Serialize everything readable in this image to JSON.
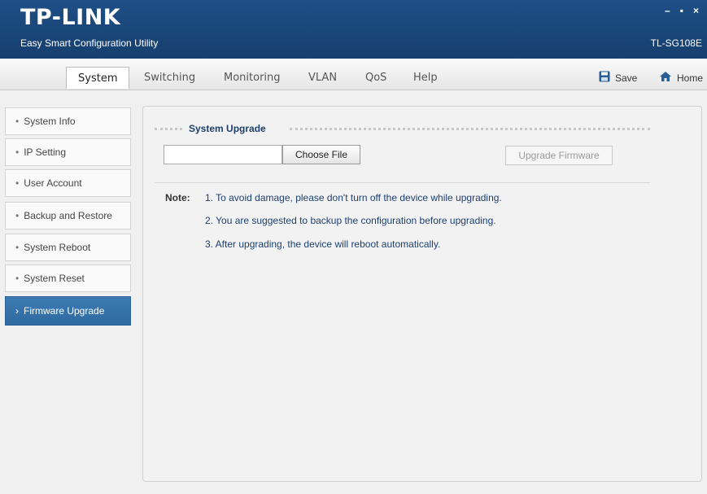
{
  "header": {
    "logo": "TP-LINK",
    "subtitle": "Easy Smart Configuration Utility",
    "model": "TL-SG108E",
    "window_controls": {
      "minimize": "–",
      "maximize": "▪",
      "close": "×"
    }
  },
  "nav": {
    "tabs": [
      {
        "label": "System",
        "active": true
      },
      {
        "label": "Switching"
      },
      {
        "label": "Monitoring"
      },
      {
        "label": "VLAN"
      },
      {
        "label": "QoS"
      },
      {
        "label": "Help"
      }
    ],
    "save_label": "Save",
    "home_label": "Home"
  },
  "sidebar": {
    "items": [
      {
        "label": "System Info"
      },
      {
        "label": "IP Setting"
      },
      {
        "label": "User Account"
      },
      {
        "label": "Backup and Restore"
      },
      {
        "label": "System Reboot"
      },
      {
        "label": "System Reset"
      },
      {
        "label": "Firmware Upgrade",
        "active": true
      }
    ]
  },
  "main": {
    "section_title": "System Upgrade",
    "file_input_value": "",
    "choose_file_label": "Choose File",
    "upgrade_button_label": "Upgrade Firmware",
    "note_label": "Note:",
    "notes": [
      "1. To avoid damage, please don't turn off the device while upgrading.",
      "2. You are suggested to backup the configuration before upgrading.",
      "3. After upgrading, the device will reboot automatically."
    ]
  },
  "colors": {
    "header_bg": "#1f4f86",
    "accent_blue": "#2f6aa0",
    "text_blue": "#1d3f6e"
  }
}
